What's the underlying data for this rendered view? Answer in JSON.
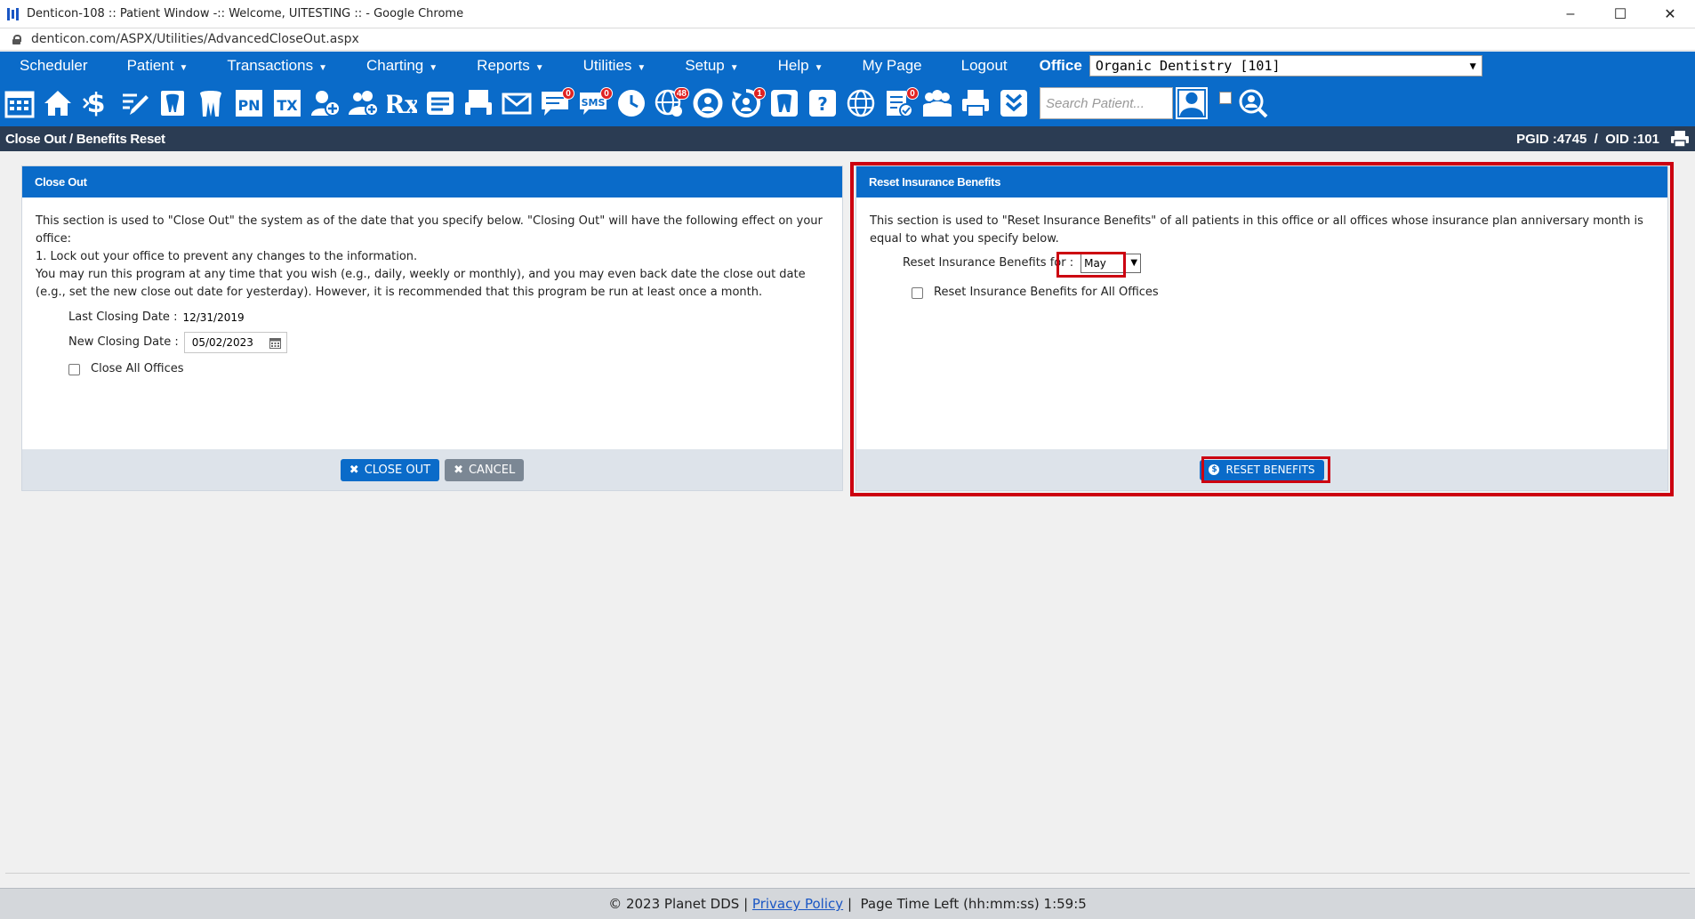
{
  "window": {
    "title": "Denticon-108 :: Patient Window -:: Welcome, UITESTING :: - Google Chrome",
    "url": "denticon.com/ASPX/Utilities/AdvancedCloseOut.aspx",
    "minimize": "–",
    "maximize": "☐",
    "close": "✕"
  },
  "menu": {
    "items": [
      {
        "label": "Scheduler",
        "caret": ""
      },
      {
        "label": "Patient",
        "caret": "▼"
      },
      {
        "label": "Transactions",
        "caret": "▼"
      },
      {
        "label": "Charting",
        "caret": "▼"
      },
      {
        "label": "Reports",
        "caret": "▼"
      },
      {
        "label": "Utilities",
        "caret": "▼"
      },
      {
        "label": "Setup",
        "caret": "▼"
      },
      {
        "label": "Help",
        "caret": "▼"
      },
      {
        "label": "My Page",
        "caret": ""
      },
      {
        "label": "Logout",
        "caret": ""
      }
    ],
    "office_label": "Office",
    "office_value": "Organic Dentistry [101]"
  },
  "toolbar": {
    "pn_label": "PN",
    "tx_label": "TX",
    "rx_label": "Rx",
    "sms_label": "SMS",
    "badge_messages": "0",
    "badge_sms": "0",
    "badge_alerts": "48",
    "badge_recall": "1",
    "badge_forms": "0",
    "search_placeholder": "Search Patient..."
  },
  "page_header": {
    "title": "Close Out / Benefits Reset",
    "ids": "PGID :4745  /  OID :101"
  },
  "close_out": {
    "title": "Close Out",
    "desc_line1": "This section is used to \"Close Out\" the system as of the date that you specify below. \"Closing Out\" will have the following effect on your office:",
    "desc_line2": "1. Lock out your office to prevent any changes to the information.",
    "desc_line3": "You may run this program at any time that you wish (e.g., daily, weekly or monthly), and you may even back date the close out date (e.g., set the new close out date for yesterday). However, it is recommended that this program be run at least once a month.",
    "last_closing_label": "Last Closing Date :",
    "last_closing_value": "12/31/2019",
    "new_closing_label": "New Closing Date :",
    "new_closing_value": "05/02/2023",
    "close_all_label": "Close All Offices",
    "close_out_button": "CLOSE OUT",
    "cancel_button": "CANCEL"
  },
  "reset_benefits": {
    "title": "Reset Insurance Benefits",
    "desc": "This section is used to \"Reset Insurance Benefits\" of all patients in this office or all offices whose insurance plan anniversary month is equal to what you specify below.",
    "reset_for_label": "Reset Insurance Benefits for :",
    "month_value": "May",
    "all_offices_label": "Reset Insurance Benefits for All Offices",
    "reset_button": "RESET BENEFITS"
  },
  "footer": {
    "copyright": "© 2023 Planet DDS |",
    "privacy": "Privacy Policy",
    "time_left": "|  Page Time Left (hh:mm:ss) 1:59:5"
  },
  "colors": {
    "brand_blue": "#0a6bc9",
    "header_dark": "#2b3c53",
    "highlight_red": "#cc0010"
  }
}
